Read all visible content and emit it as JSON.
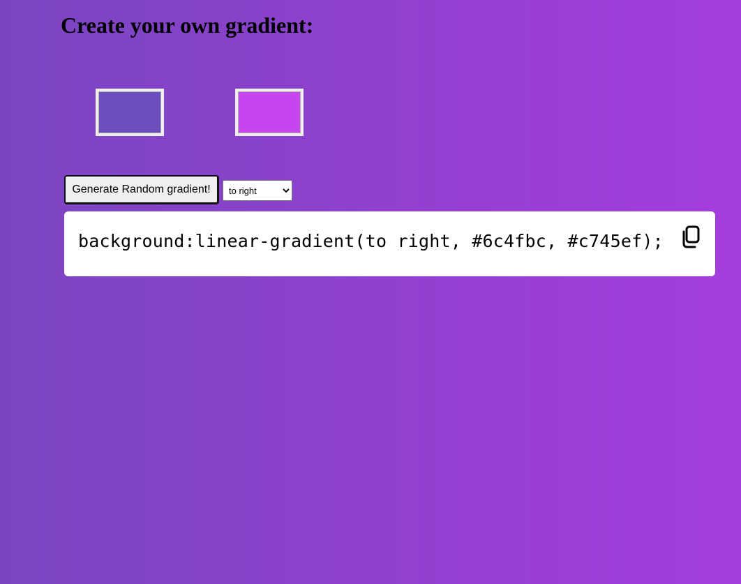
{
  "heading": "Create your own gradient:",
  "colors": {
    "color1": "#6c4fbc",
    "color2": "#c745ef",
    "page_bg_start": "#7a45c2",
    "page_bg_end": "#a53ddc"
  },
  "controls": {
    "generate_label": "Generate Random gradient!",
    "direction_selected": "to right",
    "direction_options": [
      "to right"
    ]
  },
  "output": {
    "css_text": "background:linear-gradient(to right, #6c4fbc, #c745ef);",
    "copy_icon": "copy-icon"
  }
}
